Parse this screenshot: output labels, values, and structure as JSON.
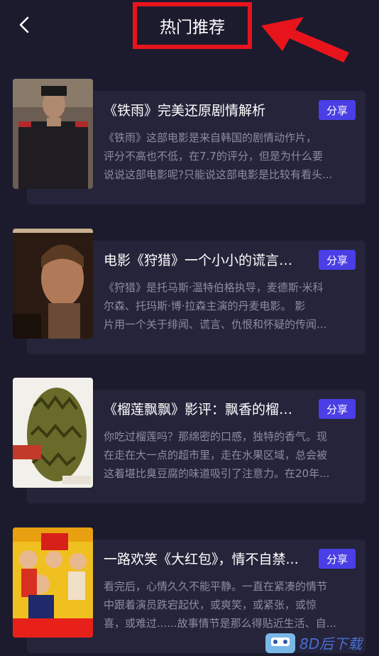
{
  "header": {
    "title": "热门推荐",
    "back_icon": "chevron-left-icon",
    "highlight_color": "#e8141c"
  },
  "articles": [
    {
      "title": "《铁雨》完美还原剧情解析",
      "share_label": "分享",
      "desc_lines": [
        "《铁雨》这部电影是来自韩国的剧情动作片，",
        "评分不高也不低，在7.7的评分，但是为什么要",
        "说说这部电影呢?只能说这部电影是比较有看头..."
      ]
    },
    {
      "title": "电影《狩猎》一个小小的谎言可...",
      "share_label": "分享",
      "desc_lines": [
        "《狩猎》是托马斯·温特伯格执导，麦德斯·米科",
        "尔森、托玛斯·博·拉森主演的丹麦电影。    影",
        "片用一个关于绯闻、谎言、仇恨和怀疑的传闻..."
      ]
    },
    {
      "title": "《榴莲飘飘》影评：飘香的榴莲...",
      "share_label": "分享",
      "desc_lines": [
        "你吃过榴莲吗？那绵密的口感，独特的香气。现",
        "在走在大一点的超市里，走在水果区域，总会被",
        "这着堪比臭豆腐的味道吸引了注意力。在20年..."
      ]
    },
    {
      "title": "一路欢笑《大红包》，情不自禁...",
      "share_label": "分享",
      "desc_lines": [
        "看完后，心情久久不能平静。一直在紧凑的情节",
        "中跟着演员跌宕起伏，或爽笑，或紧张，或惊",
        "喜，或难过......故事情节是那么得贴近生活、自..."
      ]
    }
  ],
  "colors": {
    "background": "#1c1b2e",
    "card": "#25243a",
    "share_button": "#4a3ee6",
    "description": "#8d8ca3"
  },
  "watermark": {
    "text": "8D后下载"
  }
}
